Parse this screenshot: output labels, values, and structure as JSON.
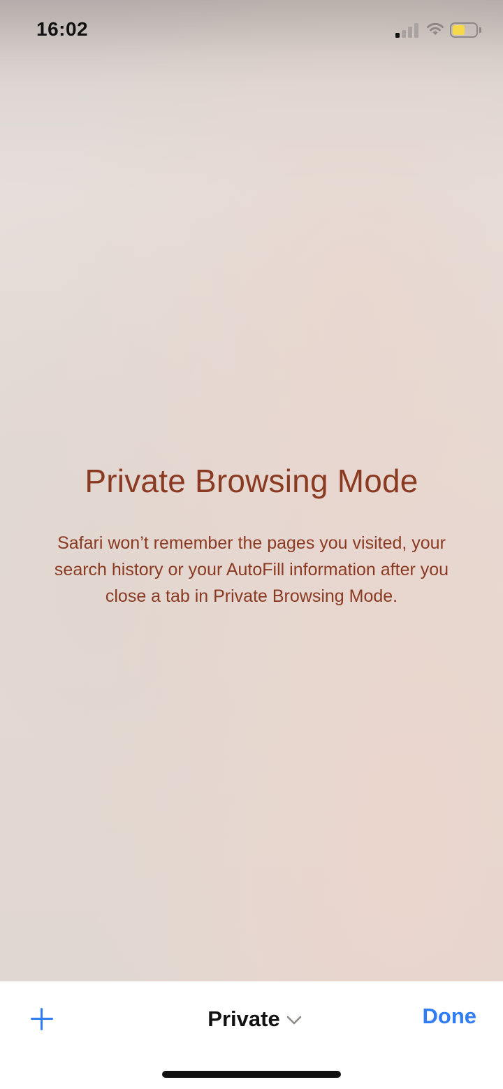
{
  "status_bar": {
    "time": "16:02",
    "signal_icon": "cellular-signal-icon",
    "wifi_icon": "wifi-icon",
    "battery_icon": "battery-icon",
    "battery_color": "#f5d94a"
  },
  "private_mode": {
    "title": "Private Browsing Mode",
    "description": "Safari won’t remember the pages you visited, your search history or your AutoFill information after you close a tab in Private Browsing Mode.",
    "text_color": "#8b3a22"
  },
  "toolbar": {
    "add_icon": "plus-icon",
    "tab_group_label": "Private",
    "tab_group_icon": "chevron-down-icon",
    "done_label": "Done",
    "accent_color": "#2f7cf6"
  }
}
